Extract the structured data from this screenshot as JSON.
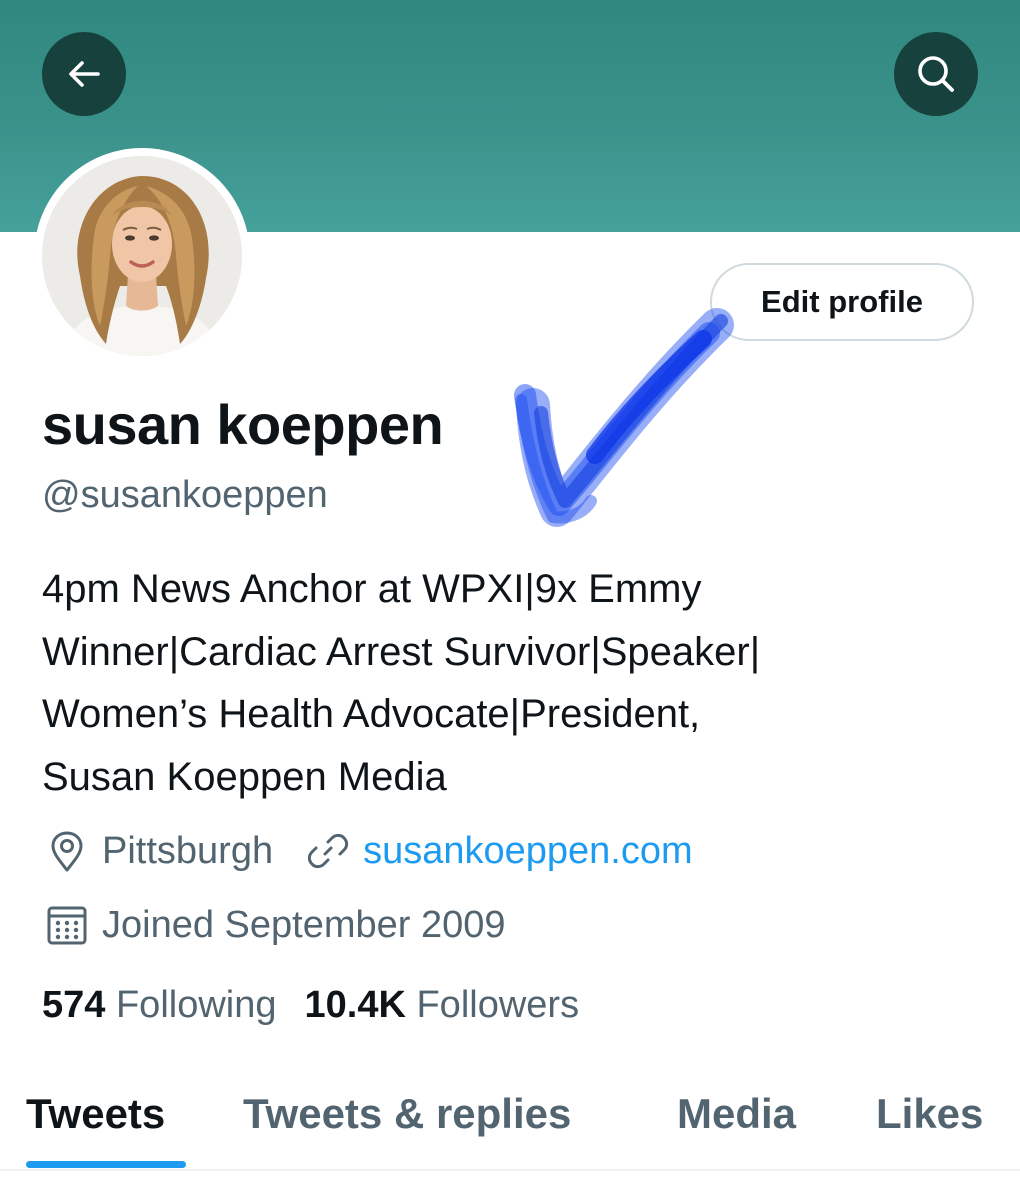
{
  "colors": {
    "banner": "#3b928b",
    "accent": "#1d9bf0",
    "text_primary": "#0f1419",
    "text_secondary": "#536471",
    "annotation": "#1a4cf0"
  },
  "header": {
    "back_icon": "arrow-left-icon",
    "search_icon": "search-icon"
  },
  "profile": {
    "avatar": "profile-photo",
    "edit_button": "Edit profile",
    "display_name": "susan koeppen",
    "handle": "@susankoeppen",
    "bio_lines": [
      "4pm News Anchor at WPXI|9x Emmy",
      "Winner|Cardiac Arrest Survivor|Speaker|",
      "Women’s Health Advocate|President,",
      "Susan Koeppen Media"
    ],
    "location": "Pittsburgh",
    "website": "susankoeppen.com",
    "joined": "Joined September 2009",
    "following_count": "574",
    "following_label": "Following",
    "followers_count": "10.4K",
    "followers_label": "Followers"
  },
  "tabs": [
    {
      "label": "Tweets",
      "active": true
    },
    {
      "label": "Tweets & replies",
      "active": false
    },
    {
      "label": "Media",
      "active": false
    },
    {
      "label": "Likes",
      "active": false
    }
  ],
  "annotation": {
    "type": "hand-drawn checkmark",
    "color": "#1a4cf0"
  }
}
